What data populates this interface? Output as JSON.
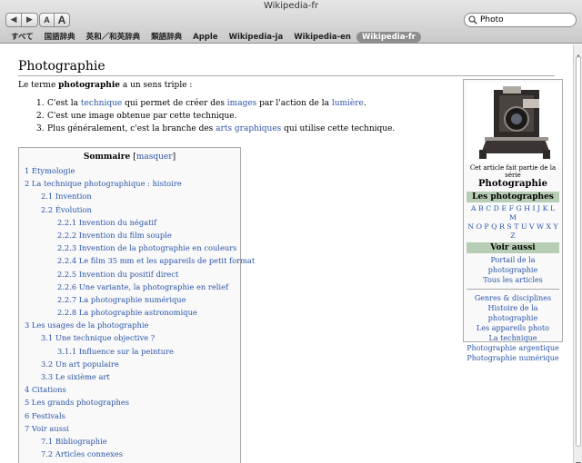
{
  "window": {
    "title": "Wikipedia-fr"
  },
  "toolbar": {
    "back": "◀",
    "forward": "▶",
    "font_small": "A",
    "font_big": "A",
    "search_value": "Photo"
  },
  "bookmarks": [
    "すべて",
    "国語辞典",
    "英和／和英辞典",
    "類語辞典",
    "Apple",
    "Wikipedia-ja",
    "Wikipedia-en",
    "Wikipedia-fr"
  ],
  "article": {
    "title": "Photographie",
    "intro_prefix": "Le terme ",
    "intro_bold": "photographie",
    "intro_suffix": " a un sens triple :",
    "senses": [
      {
        "n": "1.",
        "parts": [
          [
            "C'est la ",
            false
          ],
          [
            "technique",
            true
          ],
          [
            " qui permet de créer des ",
            false
          ],
          [
            "images",
            true
          ],
          [
            " par l'action de la ",
            false
          ],
          [
            "lumière",
            true
          ],
          [
            ".",
            false
          ]
        ]
      },
      {
        "n": "2.",
        "parts": [
          [
            "C'est une image obtenue par cette technique.",
            false
          ]
        ]
      },
      {
        "n": "3.",
        "parts": [
          [
            "Plus généralement, c'est la branche des ",
            false
          ],
          [
            "arts graphiques",
            true
          ],
          [
            " qui utilise cette technique.",
            false
          ]
        ]
      }
    ]
  },
  "toc": {
    "title": "Sommaire",
    "toggle": "masquer",
    "items": [
      {
        "level": 0,
        "text": "1 Étymologie"
      },
      {
        "level": 0,
        "text": "2 La technique photographique : histoire"
      },
      {
        "level": 1,
        "text": "2.1 Invention"
      },
      {
        "level": 1,
        "text": "2.2 Évolution"
      },
      {
        "level": 2,
        "text": "2.2.1 Invention du négatif"
      },
      {
        "level": 2,
        "text": "2.2.2 Invention du film souple"
      },
      {
        "level": 2,
        "text": "2.2.3 Invention de la photographie en couleurs"
      },
      {
        "level": 2,
        "text": "2.2.4 Le film 35 mm et les appareils de petit format"
      },
      {
        "level": 2,
        "text": "2.2.5 Invention du positif direct"
      },
      {
        "level": 2,
        "text": "2.2.6 Une variante, la photographie en relief"
      },
      {
        "level": 2,
        "text": "2.2.7 La photographie numérique"
      },
      {
        "level": 2,
        "text": "2.2.8 La photographie astronomique"
      },
      {
        "level": 0,
        "text": "3 Les usages de la photographie"
      },
      {
        "level": 1,
        "text": "3.1 Une technique objective ?"
      },
      {
        "level": 2,
        "text": "3.1.1 Influence sur la peinture"
      },
      {
        "level": 1,
        "text": "3.2 Un art populaire"
      },
      {
        "level": 1,
        "text": "3.3 Le sixième art"
      },
      {
        "level": 0,
        "text": "4 Citations"
      },
      {
        "level": 0,
        "text": "5 Les grands photographes"
      },
      {
        "level": 0,
        "text": "6 Festivals"
      },
      {
        "level": 0,
        "text": "7 Voir aussi"
      },
      {
        "level": 1,
        "text": "7.1 Bibliographie"
      },
      {
        "level": 1,
        "text": "7.2 Articles connexes"
      }
    ]
  },
  "infobox": {
    "serie_label": "Cet article fait partie de la série",
    "serie_name": "Photographie",
    "band_photographers": "Les photographes",
    "letters_line1": "A B C D E F G H I J K L M",
    "letters_line2": "N O P Q R S T U V W X Y Z",
    "band_see_also": "Voir aussi",
    "links_a": [
      "Portail de la photographie",
      "Tous les articles"
    ],
    "links_b": [
      "Genres & disciplines",
      "Histoire de la photographie",
      "Les appareils photo",
      "La technique",
      "Photographie argentique",
      "Photographie numérique"
    ]
  },
  "colors": {
    "link": "#2a55a8",
    "band": "#b8cdb5"
  }
}
